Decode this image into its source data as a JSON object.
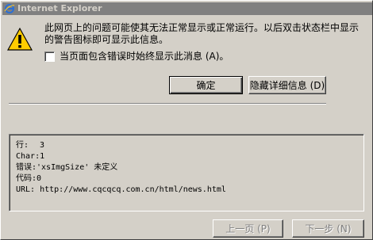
{
  "window": {
    "title": "Internet Explorer"
  },
  "dialog": {
    "message": "此网页上的问题可能使其无法正常显示或正常运行。以后双击状态栏中显示的警告图标即可显示此信息。",
    "checkbox_label": "当页面包含错误时始终显示此消息 (A)。",
    "checkbox_checked": false
  },
  "buttons": {
    "ok": "确定",
    "hide_details": "隐藏详细信息 (D)",
    "prev": "上一页 (P)",
    "next": "下一步 (N)"
  },
  "details": {
    "line_label": "行:",
    "line_value": "3",
    "char": "Char:1",
    "error": "错误:'xsImgSize' 未定义",
    "code": "代码:0",
    "url": "URL: http://www.cqcqcq.com.cn/html/news.html"
  },
  "icons": {
    "title": "ie-icon",
    "warning": "warning-icon"
  },
  "colors": {
    "titlebar": "#808080",
    "face": "#d4d0c8",
    "warning": "#ffcc00"
  }
}
